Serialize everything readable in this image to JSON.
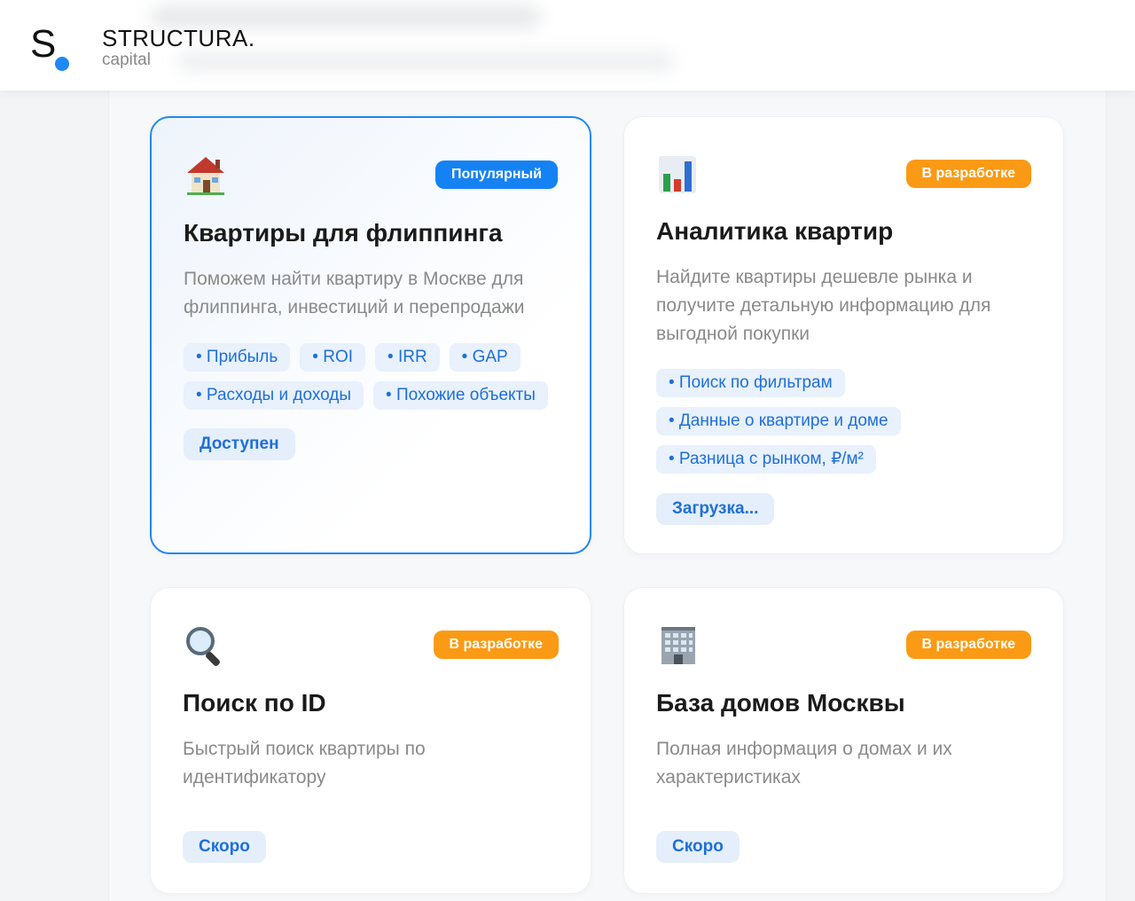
{
  "header": {
    "logo_letter": "S",
    "brand_name": "STRUCTURA.",
    "brand_sub": "capital"
  },
  "colors": {
    "accent": "#1e88f5",
    "popular_badge": "#1582f4",
    "dev_badge": "#fb9a14"
  },
  "cards": [
    {
      "icon": "house-icon",
      "badge": "Популярный",
      "title": "Квартиры для флиппинга",
      "desc_lines": [
        "Поможем найти квартиру в Москве для",
        "флиппинга, инвестиций и перепродажи"
      ],
      "tags": [
        "• Прибыль",
        "• ROI",
        "• IRR",
        "• GAP",
        "• Расходы и доходы",
        "• Похожие объекты"
      ],
      "status": "Доступен"
    },
    {
      "icon": "bar-chart-icon",
      "badge": "В разработке",
      "title": "Аналитика квартир",
      "desc_lines": [
        "Найдите квартиры дешевле рынка и",
        "получите детальную информацию для",
        "выгодной покупки"
      ],
      "tags": [
        "• Поиск по фильтрам",
        "• Данные о квартире и доме",
        "• Разница с рынком, ₽/м²"
      ],
      "status": "Загрузка..."
    },
    {
      "icon": "magnifier-icon",
      "badge": "В разработке",
      "title": "Поиск по ID",
      "desc_lines": [
        "Быстрый поиск квартиры по",
        "идентификатору"
      ],
      "tags": [],
      "status": "Скоро"
    },
    {
      "icon": "office-building-icon",
      "badge": "В разработке",
      "title": "База домов Москвы",
      "desc_lines": [
        "Полная информация о домах и их",
        "характеристиках"
      ],
      "tags": [],
      "status": "Скоро"
    }
  ]
}
